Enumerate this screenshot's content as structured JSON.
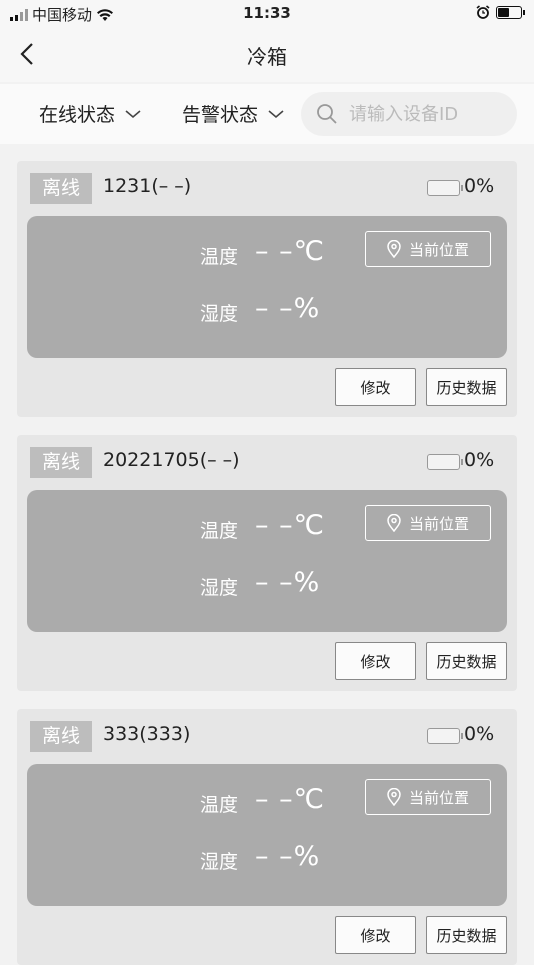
{
  "status_bar": {
    "carrier": "中国移动",
    "time": "11:33"
  },
  "nav": {
    "title": "冷箱"
  },
  "filters": {
    "online_status": "在线状态",
    "alarm_status": "告警状态",
    "search_placeholder": "请输入设备ID"
  },
  "labels": {
    "temperature": "温度",
    "humidity": "湿度",
    "location_button": "当前位置",
    "edit_button": "修改",
    "history_button": "历史数据"
  },
  "devices": [
    {
      "status": "离线",
      "name": "1231(– –)",
      "battery": "0%",
      "temperature": "– –℃",
      "humidity": "– –%"
    },
    {
      "status": "离线",
      "name": "20221705(– –)",
      "battery": "0%",
      "temperature": "– –℃",
      "humidity": "– –%"
    },
    {
      "status": "离线",
      "name": "333(333)",
      "battery": "0%",
      "temperature": "– –℃",
      "humidity": "– –%"
    }
  ]
}
